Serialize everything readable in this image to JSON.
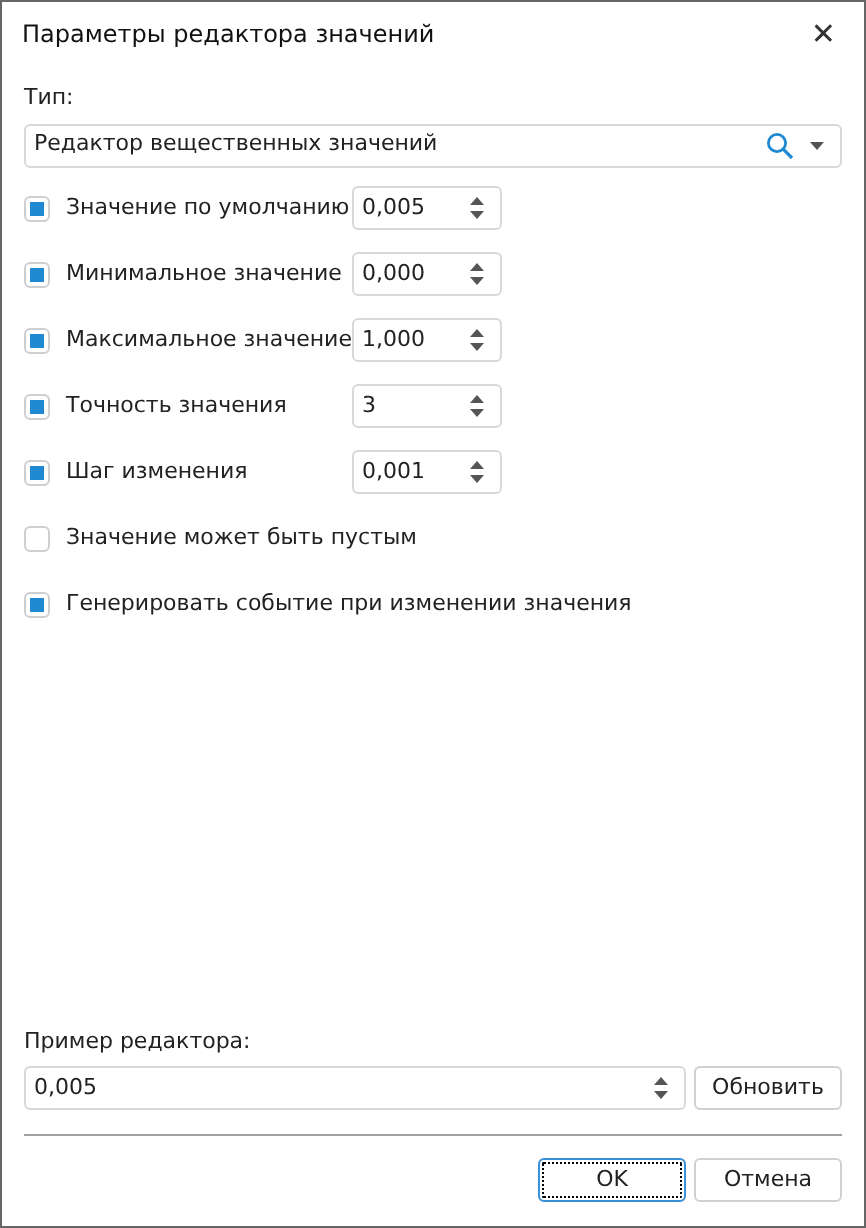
{
  "window": {
    "title": "Параметры редактора значений",
    "close": "✕"
  },
  "type_label": "Тип:",
  "type_field": {
    "value": "Редактор вещественных значений"
  },
  "options": [
    {
      "kind": "spin",
      "label": "Значение по умолчанию",
      "checked": true,
      "value": "0,005"
    },
    {
      "kind": "spin",
      "label": "Минимальное значение",
      "checked": true,
      "value": "0,000"
    },
    {
      "kind": "spin",
      "label": "Максимальное значение",
      "checked": true,
      "value": "1,000"
    },
    {
      "kind": "spin",
      "label": "Точность значения",
      "checked": true,
      "value": "3"
    },
    {
      "kind": "spin",
      "label": "Шаг изменения",
      "checked": true,
      "value": "0,001"
    },
    {
      "kind": "check",
      "label": "Значение может быть пустым",
      "checked": false
    },
    {
      "kind": "check",
      "label": "Генерировать событие при изменении значения",
      "checked": true
    }
  ],
  "preview": {
    "label": "Пример редактора:",
    "value": "0,005",
    "button": "Обновить"
  },
  "buttons": [
    {
      "label": "OK",
      "focused": true
    },
    {
      "label": "Отмена",
      "focused": false
    }
  ]
}
